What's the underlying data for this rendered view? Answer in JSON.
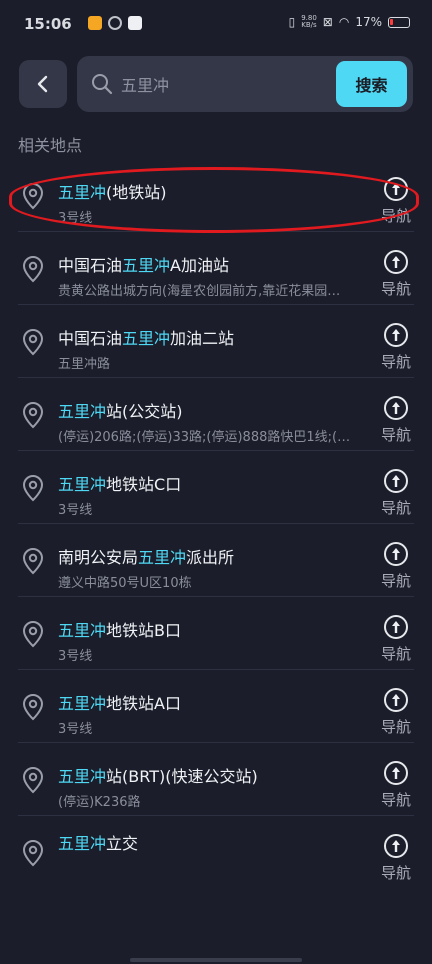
{
  "status_bar": {
    "time": "15:06",
    "speed_top": "9.80",
    "speed_bottom": "KB/s",
    "battery": "17%"
  },
  "search": {
    "placeholder": "五里冲",
    "button_label": "搜索"
  },
  "section_title": "相关地点",
  "nav_label": "导航",
  "colors": {
    "accent": "#4fd8f3",
    "background": "#1b1d2a",
    "highlight_ring": "#e01a1f"
  },
  "results": [
    {
      "pre": "",
      "hl": "五里冲",
      "post": "(地铁站)",
      "sub": "3号线"
    },
    {
      "pre": "中国石油",
      "hl": "五里冲",
      "post": "A加油站",
      "sub": "贵黄公路出城方向(海星农创园前方,靠近花果园…"
    },
    {
      "pre": "中国石油",
      "hl": "五里冲",
      "post": "加油二站",
      "sub": "五里冲路"
    },
    {
      "pre": "",
      "hl": "五里冲",
      "post": "站(公交站)",
      "sub": "(停运)206路;(停运)33路;(停运)888路快巴1线;(…"
    },
    {
      "pre": "",
      "hl": "五里冲",
      "post": "地铁站C口",
      "sub": "3号线"
    },
    {
      "pre": "南明公安局",
      "hl": "五里冲",
      "post": "派出所",
      "sub": "遵义中路50号U区10栋"
    },
    {
      "pre": "",
      "hl": "五里冲",
      "post": "地铁站B口",
      "sub": "3号线"
    },
    {
      "pre": "",
      "hl": "五里冲",
      "post": "地铁站A口",
      "sub": "3号线"
    },
    {
      "pre": "",
      "hl": "五里冲",
      "post": "站(BRT)(快速公交站)",
      "sub": "(停运)K236路"
    },
    {
      "pre": "",
      "hl": "五里冲",
      "post": "立交",
      "sub": ""
    }
  ]
}
